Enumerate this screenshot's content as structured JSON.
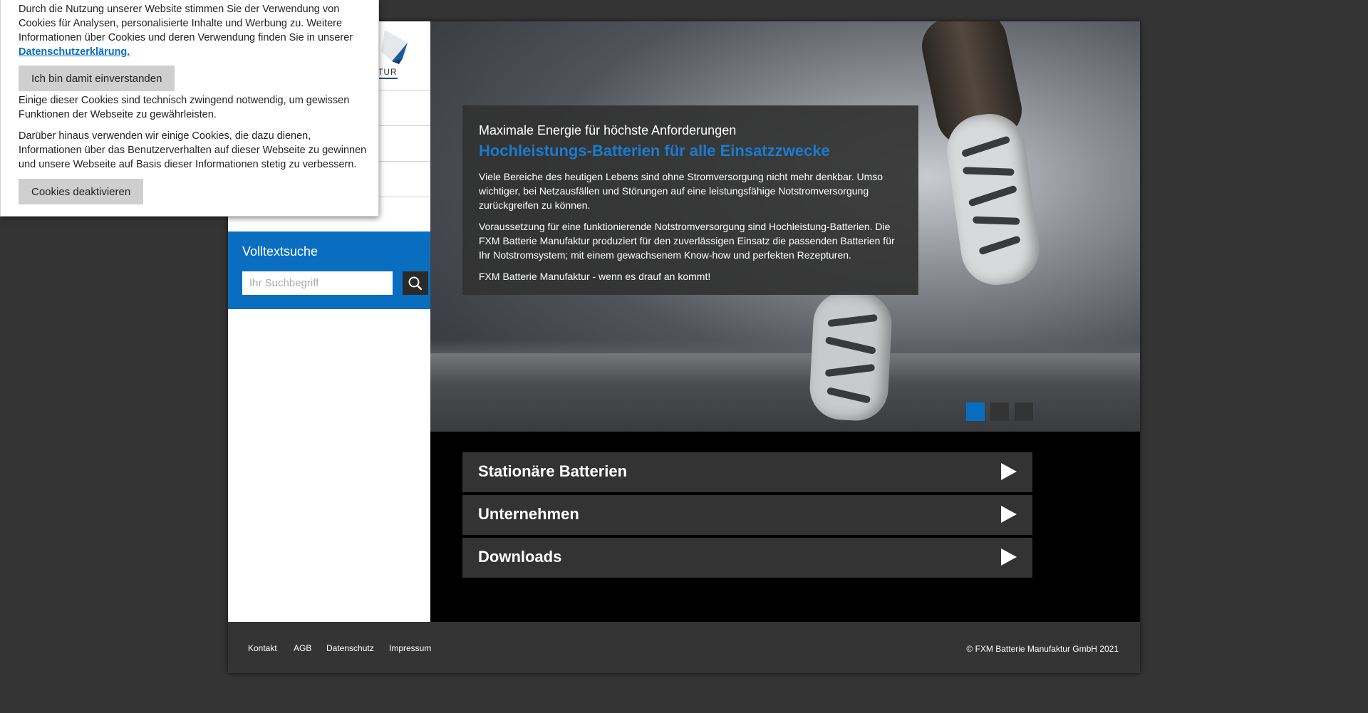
{
  "sidebar": {
    "logo_text": "TUR",
    "search_title": "Volltextsuche",
    "search_placeholder": "Ihr Suchbegriff"
  },
  "hero": {
    "subtitle": "Maximale Energie für höchste Anforderungen",
    "title": "Hochleistungs-Batterien für alle Einsatzzwecke",
    "paragraphs": [
      "Viele Bereiche des heutigen Lebens sind ohne Stromversorgung nicht mehr denkbar. Umso wichtiger, bei Netzausfällen und Störungen auf eine leistungsfähige Notstromversorgung zurückgreifen zu können.",
      "Voraussetzung für eine funktionierende Notstromversorgung sind Hochleistung-Batterien. Die FXM Batterie Manufaktur produziert für den zuverlässigen Einsatz die passenden Batterien für Ihr Notstromsystem; mit einem gewachsenem Know-how und perfekten Rezepturen.",
      "FXM Batterie Manufaktur - wenn es drauf an kommt!"
    ]
  },
  "categories": [
    {
      "label": "Stationäre Batterien"
    },
    {
      "label": "Unternehmen"
    },
    {
      "label": "Downloads"
    }
  ],
  "footer": {
    "links": [
      "Kontakt",
      "AGB",
      "Datenschutz",
      "Impressum"
    ],
    "copyright": "© FXM Batterie Manufaktur GmbH  2021"
  },
  "cookie": {
    "intro": "Durch die Nutzung unserer Website stimmen Sie der Verwendung von Cookies für Analysen, personalisierte Inhalte und Werbung zu. Weitere Informationen über Cookies und deren Verwendung finden Sie in unserer",
    "link_label": "Datenschutzerklärung.",
    "accept_label": "Ich bin damit einverstanden",
    "technical_text": "Einige dieser Cookies sind technisch zwingend notwendig, um gewissen Funktionen der Webseite zu gewährleisten.",
    "analytics_text": "Darüber hinaus verwenden wir einige Cookies, die dazu dienen, Informationen über das Benutzerverhalten auf dieser Webseite zu gewinnen und unsere Webseite auf Basis dieser Informationen stetig zu verbessern.",
    "deactivate_label": "Cookies deaktivieren"
  },
  "colors": {
    "accent": "#0a6ec0",
    "background": "#343434"
  },
  "slider": {
    "total": 3,
    "active": 1
  }
}
